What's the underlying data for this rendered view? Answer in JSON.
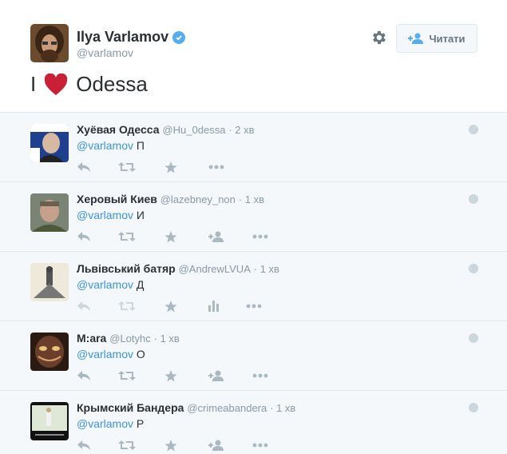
{
  "main_tweet": {
    "name": "Ilya Varlamov",
    "handle": "@varlamov",
    "follow_label": "Читати",
    "text_before": "I",
    "text_after": "Odessa"
  },
  "replies": [
    {
      "name": "Хуёвая Одесса",
      "handle": "@Hu_0dessa",
      "time": "· 2 хв",
      "mention": "@varlamov",
      "text": "П",
      "fourth_action": "none"
    },
    {
      "name": "Херовый Киев",
      "handle": "@lazebney_non",
      "time": "· 1 хв",
      "mention": "@varlamov",
      "text": "И",
      "fourth_action": "follow"
    },
    {
      "name": "Львівський батяр",
      "handle": "@AndrewLVUA",
      "time": "· 1 хв",
      "mention": "@varlamov",
      "text": "Д",
      "fourth_action": "analytics"
    },
    {
      "name": "M:ara",
      "handle": "@Lotyhc",
      "time": "· 1 хв",
      "mention": "@varlamov",
      "text": "О",
      "fourth_action": "follow"
    },
    {
      "name": "Крымский Бандера",
      "handle": "@crimeabandera",
      "time": "· 1 хв",
      "mention": "@varlamov",
      "text": "Р",
      "fourth_action": "follow"
    }
  ],
  "colors": {
    "accent": "#55acee",
    "link": "#3b94d9",
    "heart": "#e0245e",
    "muted": "#8899a6",
    "icon": "#aab8c2"
  }
}
